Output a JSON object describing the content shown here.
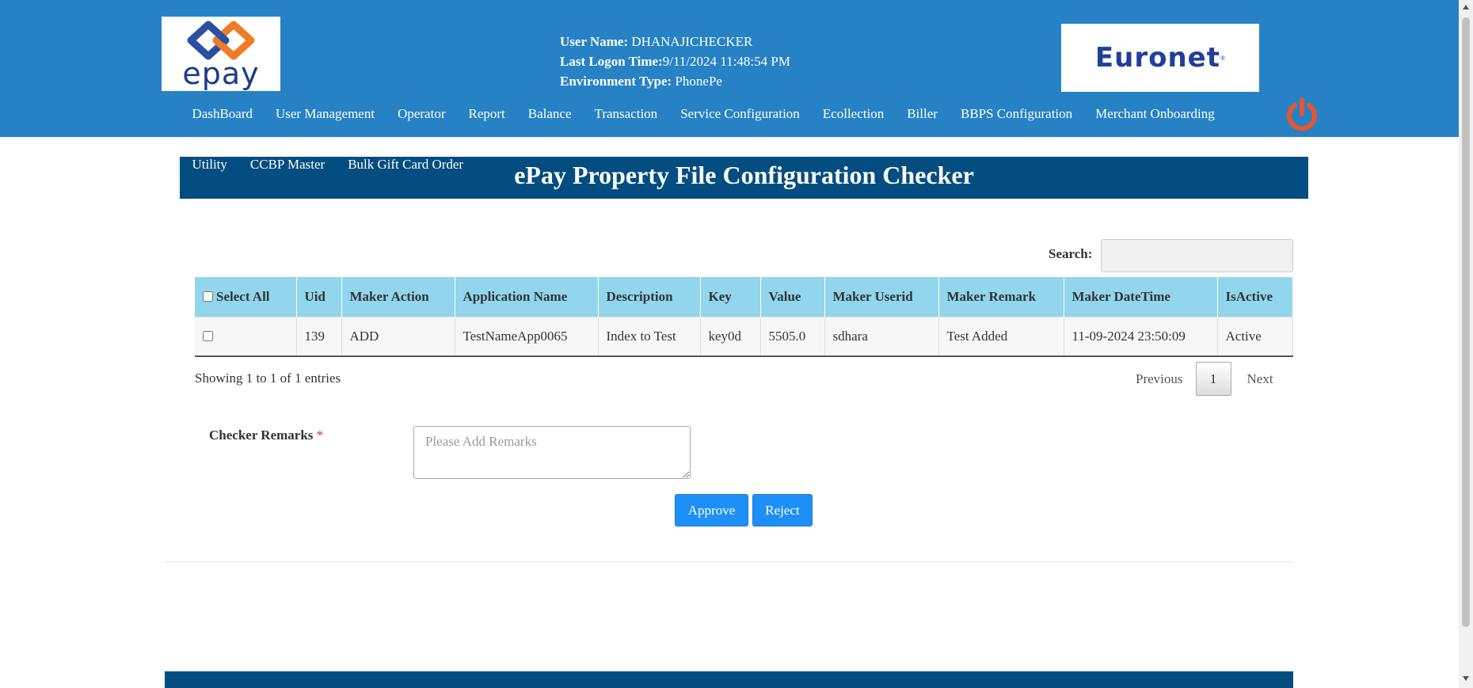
{
  "header": {
    "logo_text": "epay",
    "user_name_label": "User Name:",
    "user_name": " DHANAJICHECKER",
    "last_logon_label": "Last Logon Time:",
    "last_logon": "9/11/2024 11:48:54 PM",
    "env_label": "Environment Type:",
    "env": " PhonePe",
    "partner_logo_text": "Euronet",
    "partner_logo_mark": "®"
  },
  "nav": {
    "items": [
      {
        "label": "DashBoard"
      },
      {
        "label": "User Management"
      },
      {
        "label": "Operator"
      },
      {
        "label": "Report"
      },
      {
        "label": "Balance"
      },
      {
        "label": "Transaction"
      },
      {
        "label": "Service Configuration"
      },
      {
        "label": "Ecollection"
      },
      {
        "label": "Biller"
      },
      {
        "label": "BBPS Configuration"
      },
      {
        "label": "Merchant Onboarding"
      }
    ],
    "sub_items": [
      {
        "label": "Utility"
      },
      {
        "label": "CCBP Master"
      },
      {
        "label": "Bulk Gift Card Order"
      }
    ],
    "power_icon": "power-icon",
    "power_color": "#e8552e"
  },
  "page": {
    "title": "ePay Property File Configuration Checker"
  },
  "search": {
    "label": "Search:",
    "value": ""
  },
  "table": {
    "columns": [
      "Select All",
      "Uid",
      "Maker Action",
      "Application Name",
      "Description",
      "Key",
      "Value",
      "Maker Userid",
      "Maker Remark",
      "Maker DateTime",
      "IsActive"
    ],
    "rows": [
      [
        "",
        "139",
        "ADD",
        "TestNameApp0065",
        "Index to Test",
        "key0d",
        "5505.0",
        "sdhara",
        "Test Added",
        "11-09-2024 23:50:09",
        "Active"
      ]
    ],
    "header_color": "#91d6ed"
  },
  "pagination": {
    "info": "Showing 1 to 1 of 1 entries",
    "previous": "Previous",
    "current_page": "1",
    "next": "Next"
  },
  "form": {
    "remarks_label": "Checker Remarks",
    "required_mark": "*",
    "remarks_placeholder": "Please Add Remarks",
    "approve_label": "Approve",
    "reject_label": "Reject"
  },
  "colors": {
    "header_bg": "#2682c5",
    "title_bar_bg": "#034d80",
    "button_bg": "#1e8ff7"
  }
}
